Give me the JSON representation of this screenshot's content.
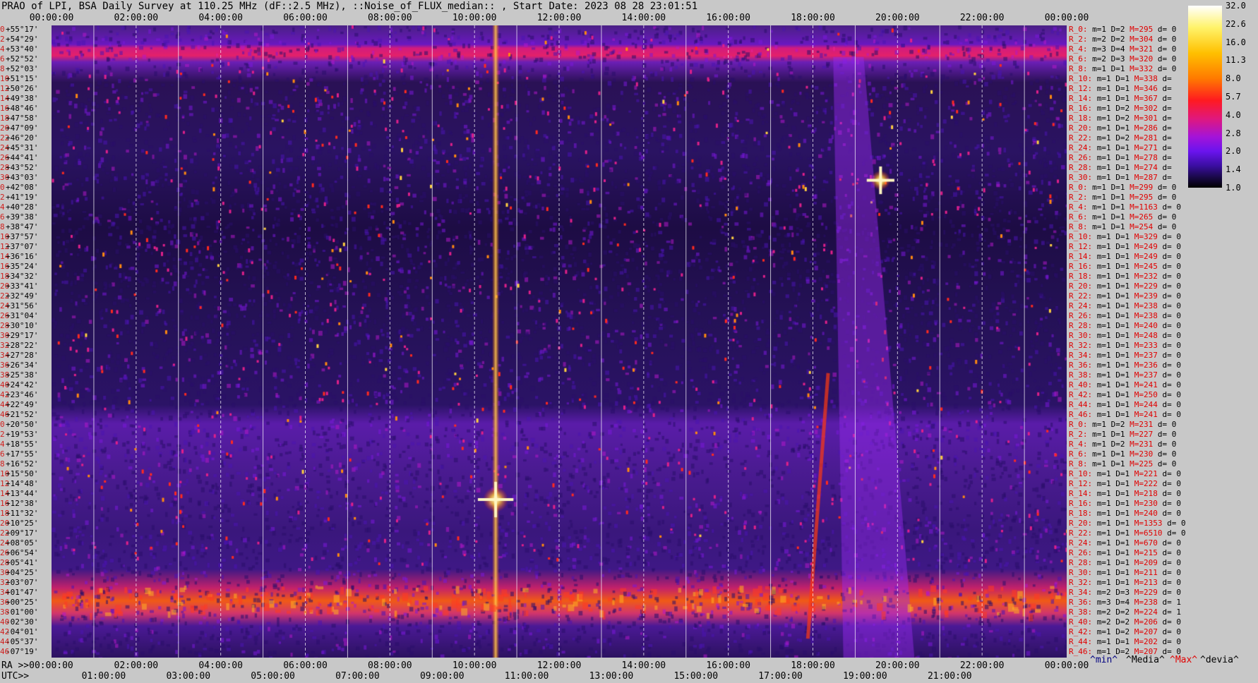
{
  "title": "PRAO of LPI, BSA Daily Survey at 110.25 MHz (dF::2.5 MHz), ::Noise_of_FLUX_median:: , Start Date: 2023 08 28 23:01:51",
  "chart_data": {
    "type": "heatmap",
    "title": "PRAO of LPI, BSA Daily Survey at 110.25 MHz (dF::2.5 MHz), ::Noise_of_FLUX_median:: , Start Date: 2023 08 28 23:01:51",
    "x_ra_ticks": [
      "00:00:00",
      "02:00:00",
      "04:00:00",
      "06:00:00",
      "08:00:00",
      "10:00:00",
      "12:00:00",
      "14:00:00",
      "16:00:00",
      "18:00:00",
      "20:00:00",
      "22:00:00",
      "00:00:00"
    ],
    "ra_axis_label": "RA >>00:00:00",
    "bottom_ra_ticks": [
      "02:00:00",
      "04:00:00",
      "06:00:00",
      "08:00:00",
      "10:00:00",
      "12:00:00",
      "14:00:00",
      "16:00:00",
      "18:00:00",
      "20:00:00",
      "22:00:00",
      "00:00:00"
    ],
    "utc_axis_label": "UTC>>",
    "utc_ticks": [
      "01:00:00",
      "03:00:00",
      "05:00:00",
      "07:00:00",
      "09:00:00",
      "11:00:00",
      "13:00:00",
      "15:00:00",
      "17:00:00",
      "19:00:00",
      "21:00:00"
    ],
    "dec_labels": [
      "+55°17'",
      "+54°29'",
      "+53°40'",
      "+52°52'",
      "+52°03'",
      "+51°15'",
      "+50°26'",
      "+49°38'",
      "+48°46'",
      "+47°58'",
      "+47°09'",
      "+46°20'",
      "+45°31'",
      "+44°41'",
      "+43°52'",
      "+43°03'",
      "+42°08'",
      "+41°19'",
      "+40°28'",
      "+39°38'",
      "+38°47'",
      "+37°57'",
      "+37°07'",
      "+36°16'",
      "+35°24'",
      "+34°32'",
      "+33°41'",
      "+32°49'",
      "+31°56'",
      "+31°04'",
      "+30°10'",
      "+29°17'",
      "+28°22'",
      "+27°28'",
      "+26°34'",
      "+25°38'",
      "+24°42'",
      "+23°46'",
      "+22°49'",
      "+21°52'",
      "+20°50'",
      "+19°53'",
      "+18°55'",
      "+17°55'",
      "+16°52'",
      "+15°50'",
      "+14°48'",
      "+13°44'",
      "+12°38'",
      "+11°32'",
      "+10°25'",
      "+09°17'",
      "+08°05'",
      "+06°54'",
      "+05°41'",
      "+04°25'",
      "+03°07'",
      "+01°47'",
      "+00°25'",
      "-01°00'",
      "-02°30'",
      "-04°01'",
      "-05°37'",
      "-07°19'"
    ],
    "dec_index": [
      "0",
      "2",
      "4",
      "6",
      "8",
      "10",
      "12",
      "14",
      "16",
      "18",
      "20",
      "22",
      "24",
      "26",
      "28",
      "30",
      "0",
      "2",
      "4",
      "6",
      "8",
      "10",
      "12",
      "14",
      "16",
      "18",
      "20",
      "22",
      "24",
      "26",
      "28",
      "30",
      "32",
      "34",
      "36",
      "38",
      "40",
      "42",
      "44",
      "46",
      "0",
      "2",
      "4",
      "6",
      "8",
      "10",
      "12",
      "14",
      "16",
      "18",
      "20",
      "22",
      "24",
      "26",
      "28",
      "30",
      "32",
      "34",
      "36",
      "38",
      "40",
      "42",
      "44",
      "46"
    ],
    "row_stats": [
      [
        "R_0:",
        "m=1",
        "D=2",
        "M=295",
        "d= 0"
      ],
      [
        "R_2:",
        "m=2",
        "D=2",
        "M=304",
        "d= 0"
      ],
      [
        "R_4:",
        "m=3",
        "D=4",
        "M=321",
        "d= 0"
      ],
      [
        "R_6:",
        "m=2",
        "D=3",
        "M=320",
        "d= 0"
      ],
      [
        "R_8:",
        "m=1",
        "D=1",
        "M=332",
        "d= 0"
      ],
      [
        "R_10:",
        "m=1",
        "D=1",
        "M=338",
        "d="
      ],
      [
        "R_12:",
        "m=1",
        "D=1",
        "M=346",
        "d="
      ],
      [
        "R_14:",
        "m=1",
        "D=1",
        "M=367",
        "d="
      ],
      [
        "R_16:",
        "m=1",
        "D=2",
        "M=302",
        "d="
      ],
      [
        "R_18:",
        "m=1",
        "D=2",
        "M=301",
        "d="
      ],
      [
        "R_20:",
        "m=1",
        "D=1",
        "M=286",
        "d="
      ],
      [
        "R_22:",
        "m=1",
        "D=2",
        "M=281",
        "d="
      ],
      [
        "R_24:",
        "m=1",
        "D=1",
        "M=271",
        "d="
      ],
      [
        "R_26:",
        "m=1",
        "D=1",
        "M=278",
        "d="
      ],
      [
        "R_28:",
        "m=1",
        "D=1",
        "M=274",
        "d="
      ],
      [
        "R_30:",
        "m=1",
        "D=1",
        "M=287",
        "d="
      ],
      [
        "R_0:",
        "m=1",
        "D=1",
        "M=299",
        "d= 0"
      ],
      [
        "R_2:",
        "m=1",
        "D=1",
        "M=295",
        "d= 0"
      ],
      [
        "R_4:",
        "m=1",
        "D=1",
        "M=1163",
        "d= 0"
      ],
      [
        "R_6:",
        "m=1",
        "D=1",
        "M=265",
        "d= 0"
      ],
      [
        "R_8:",
        "m=1",
        "D=1",
        "M=254",
        "d= 0"
      ],
      [
        "R_10:",
        "m=1",
        "D=1",
        "M=329",
        "d= 0"
      ],
      [
        "R_12:",
        "m=1",
        "D=1",
        "M=249",
        "d= 0"
      ],
      [
        "R_14:",
        "m=1",
        "D=1",
        "M=249",
        "d= 0"
      ],
      [
        "R_16:",
        "m=1",
        "D=1",
        "M=245",
        "d= 0"
      ],
      [
        "R_18:",
        "m=1",
        "D=1",
        "M=232",
        "d= 0"
      ],
      [
        "R_20:",
        "m=1",
        "D=1",
        "M=229",
        "d= 0"
      ],
      [
        "R_22:",
        "m=1",
        "D=1",
        "M=239",
        "d= 0"
      ],
      [
        "R_24:",
        "m=1",
        "D=1",
        "M=238",
        "d= 0"
      ],
      [
        "R_26:",
        "m=1",
        "D=1",
        "M=238",
        "d= 0"
      ],
      [
        "R_28:",
        "m=1",
        "D=1",
        "M=240",
        "d= 0"
      ],
      [
        "R_30:",
        "m=1",
        "D=1",
        "M=248",
        "d= 0"
      ],
      [
        "R_32:",
        "m=1",
        "D=1",
        "M=233",
        "d= 0"
      ],
      [
        "R_34:",
        "m=1",
        "D=1",
        "M=237",
        "d= 0"
      ],
      [
        "R_36:",
        "m=1",
        "D=1",
        "M=236",
        "d= 0"
      ],
      [
        "R_38:",
        "m=1",
        "D=1",
        "M=237",
        "d= 0"
      ],
      [
        "R_40:",
        "m=1",
        "D=1",
        "M=241",
        "d= 0"
      ],
      [
        "R_42:",
        "m=1",
        "D=1",
        "M=250",
        "d= 0"
      ],
      [
        "R_44:",
        "m=1",
        "D=1",
        "M=244",
        "d= 0"
      ],
      [
        "R_46:",
        "m=1",
        "D=1",
        "M=241",
        "d= 0"
      ],
      [
        "R_0:",
        "m=1",
        "D=2",
        "M=231",
        "d= 0"
      ],
      [
        "R_2:",
        "m=1",
        "D=1",
        "M=227",
        "d= 0"
      ],
      [
        "R_4:",
        "m=1",
        "D=2",
        "M=231",
        "d= 0"
      ],
      [
        "R_6:",
        "m=1",
        "D=1",
        "M=230",
        "d= 0"
      ],
      [
        "R_8:",
        "m=1",
        "D=1",
        "M=225",
        "d= 0"
      ],
      [
        "R_10:",
        "m=1",
        "D=1",
        "M=221",
        "d= 0"
      ],
      [
        "R_12:",
        "m=1",
        "D=1",
        "M=222",
        "d= 0"
      ],
      [
        "R_14:",
        "m=1",
        "D=1",
        "M=218",
        "d= 0"
      ],
      [
        "R_16:",
        "m=1",
        "D=1",
        "M=230",
        "d= 0"
      ],
      [
        "R_18:",
        "m=1",
        "D=1",
        "M=240",
        "d= 0"
      ],
      [
        "R_20:",
        "m=1",
        "D=1",
        "M=1353",
        "d= 0"
      ],
      [
        "R_22:",
        "m=1",
        "D=1",
        "M=6510",
        "d= 0"
      ],
      [
        "R_24:",
        "m=1",
        "D=1",
        "M=670",
        "d= 0"
      ],
      [
        "R_26:",
        "m=1",
        "D=1",
        "M=215",
        "d= 0"
      ],
      [
        "R_28:",
        "m=1",
        "D=1",
        "M=209",
        "d= 0"
      ],
      [
        "R_30:",
        "m=1",
        "D=1",
        "M=211",
        "d= 0"
      ],
      [
        "R_32:",
        "m=1",
        "D=1",
        "M=213",
        "d= 0"
      ],
      [
        "R_34:",
        "m=2",
        "D=3",
        "M=229",
        "d= 0"
      ],
      [
        "R_36:",
        "m=3",
        "D=4",
        "M=238",
        "d= 1"
      ],
      [
        "R_38:",
        "m=2",
        "D=2",
        "M=224",
        "d= 1"
      ],
      [
        "R_40:",
        "m=2",
        "D=2",
        "M=206",
        "d= 0"
      ],
      [
        "R_42:",
        "m=1",
        "D=2",
        "M=207",
        "d= 0"
      ],
      [
        "R_44:",
        "m=1",
        "D=1",
        "M=202",
        "d= 0"
      ],
      [
        "R_46:",
        "m=1",
        "D=2",
        "M=207",
        "d= 0"
      ]
    ],
    "colorbar_ticks": [
      "32.0",
      "22.6",
      "16.0",
      "11.3",
      "8.0",
      "5.7",
      "4.0",
      "2.8",
      "2.0",
      "1.4",
      "1.0"
    ],
    "colorscale": [
      "#000000",
      "#16083e",
      "#3a0ea0",
      "#6a14ee",
      "#a414d8",
      "#e0187c",
      "#ff1a20",
      "#ff7a00",
      "#ffc000",
      "#fff36a",
      "#ffffff"
    ],
    "footer_labels": {
      "min": "^min^",
      "media": "^Media^",
      "max": "^Max^",
      "devia": "^devia^"
    },
    "footer_colors": {
      "min": "#000080",
      "media": "#000000",
      "max": "#e00000",
      "devia": "#000000"
    }
  }
}
